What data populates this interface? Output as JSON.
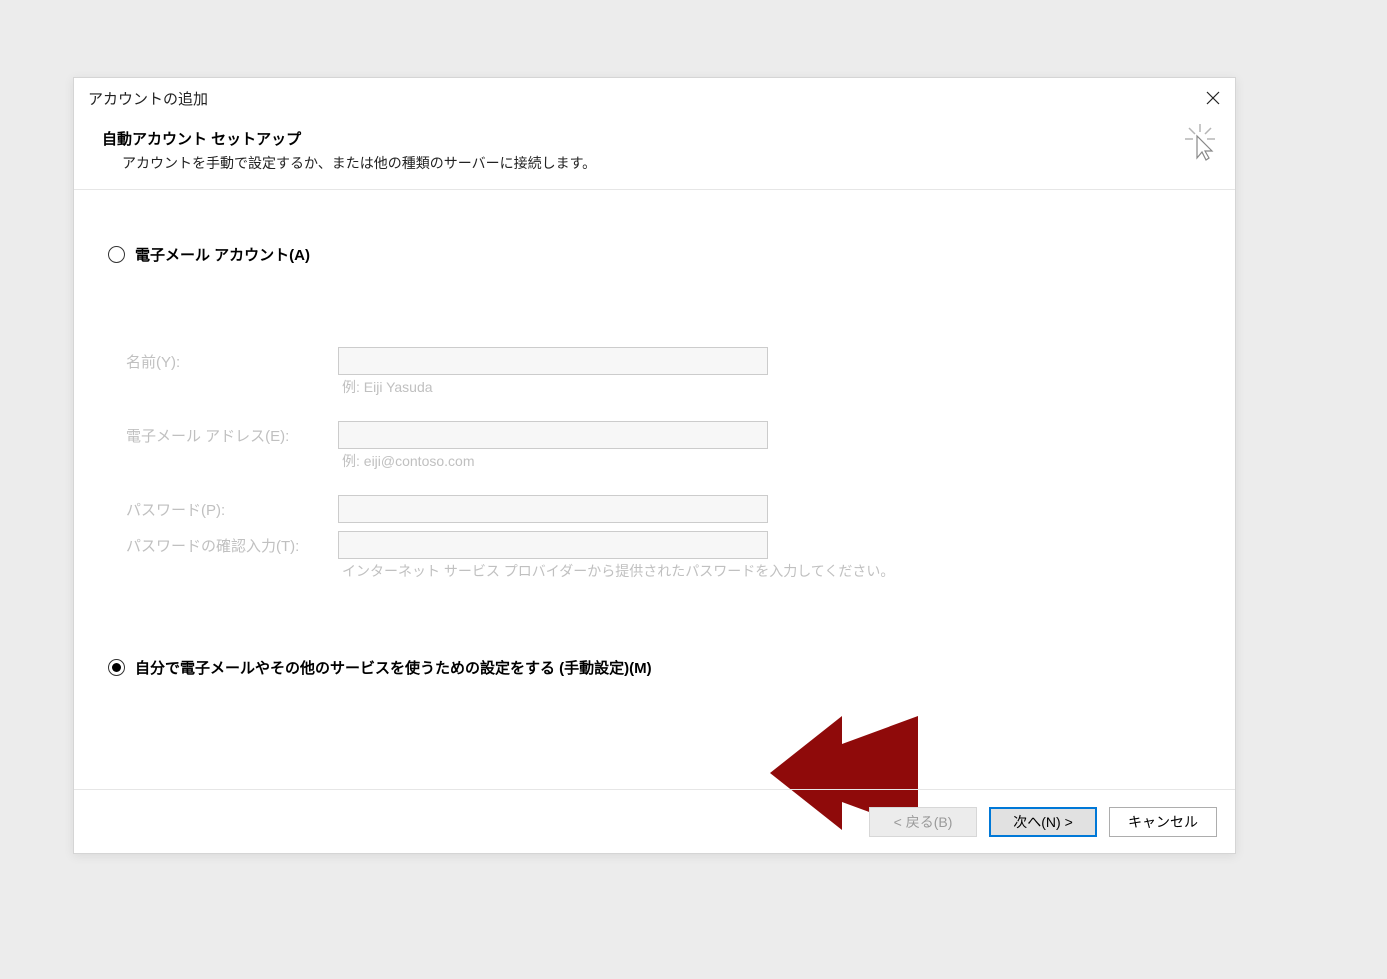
{
  "dialog": {
    "title": "アカウントの追加",
    "header_title": "自動アカウント セットアップ",
    "header_subtitle": "アカウントを手動で設定するか、または他の種類のサーバーに接続します。"
  },
  "options": {
    "email_account_label": "電子メール アカウント(A)",
    "manual_setup_label": "自分で電子メールやその他のサービスを使うための設定をする (手動設定)(M)"
  },
  "form": {
    "name_label": "名前(Y):",
    "name_hint": "例: Eiji Yasuda",
    "email_label": "電子メール アドレス(E):",
    "email_hint": "例: eiji@contoso.com",
    "password_label": "パスワード(P):",
    "password_confirm_label": "パスワードの確認入力(T):",
    "password_hint": "インターネット サービス プロバイダーから提供されたパスワードを入力してください。"
  },
  "buttons": {
    "back": "< 戻る(B)",
    "next": "次へ(N) >",
    "cancel": "キャンセル"
  },
  "annotation": {
    "arrow_color": "#8f0a0a"
  }
}
